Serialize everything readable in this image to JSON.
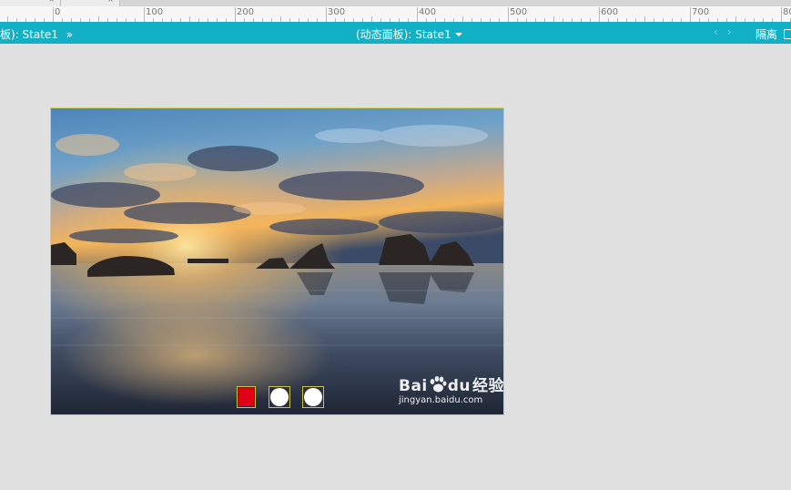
{
  "ruler": {
    "labels": [
      "0",
      "100",
      "200",
      "300",
      "400",
      "500",
      "600",
      "700",
      "80"
    ]
  },
  "state_bar": {
    "left_text": "板): State1",
    "left_arrow": "»",
    "center_text": "(动态面板): State1",
    "nav_prev": "‹",
    "nav_next": "›",
    "isolate_label": "隔离",
    "color": "#12b0c4"
  },
  "panel": {
    "image_desc_icon": "landscape-photo",
    "buttons": [
      {
        "state": "active",
        "color": "#e00016"
      },
      {
        "state": "inactive",
        "color": "#ffffff"
      },
      {
        "state": "inactive",
        "color": "#ffffff"
      }
    ]
  },
  "watermark": {
    "brand_a": "Bai",
    "brand_b": "du",
    "brand_c": "经验",
    "url": "jingyan.baidu.com"
  }
}
